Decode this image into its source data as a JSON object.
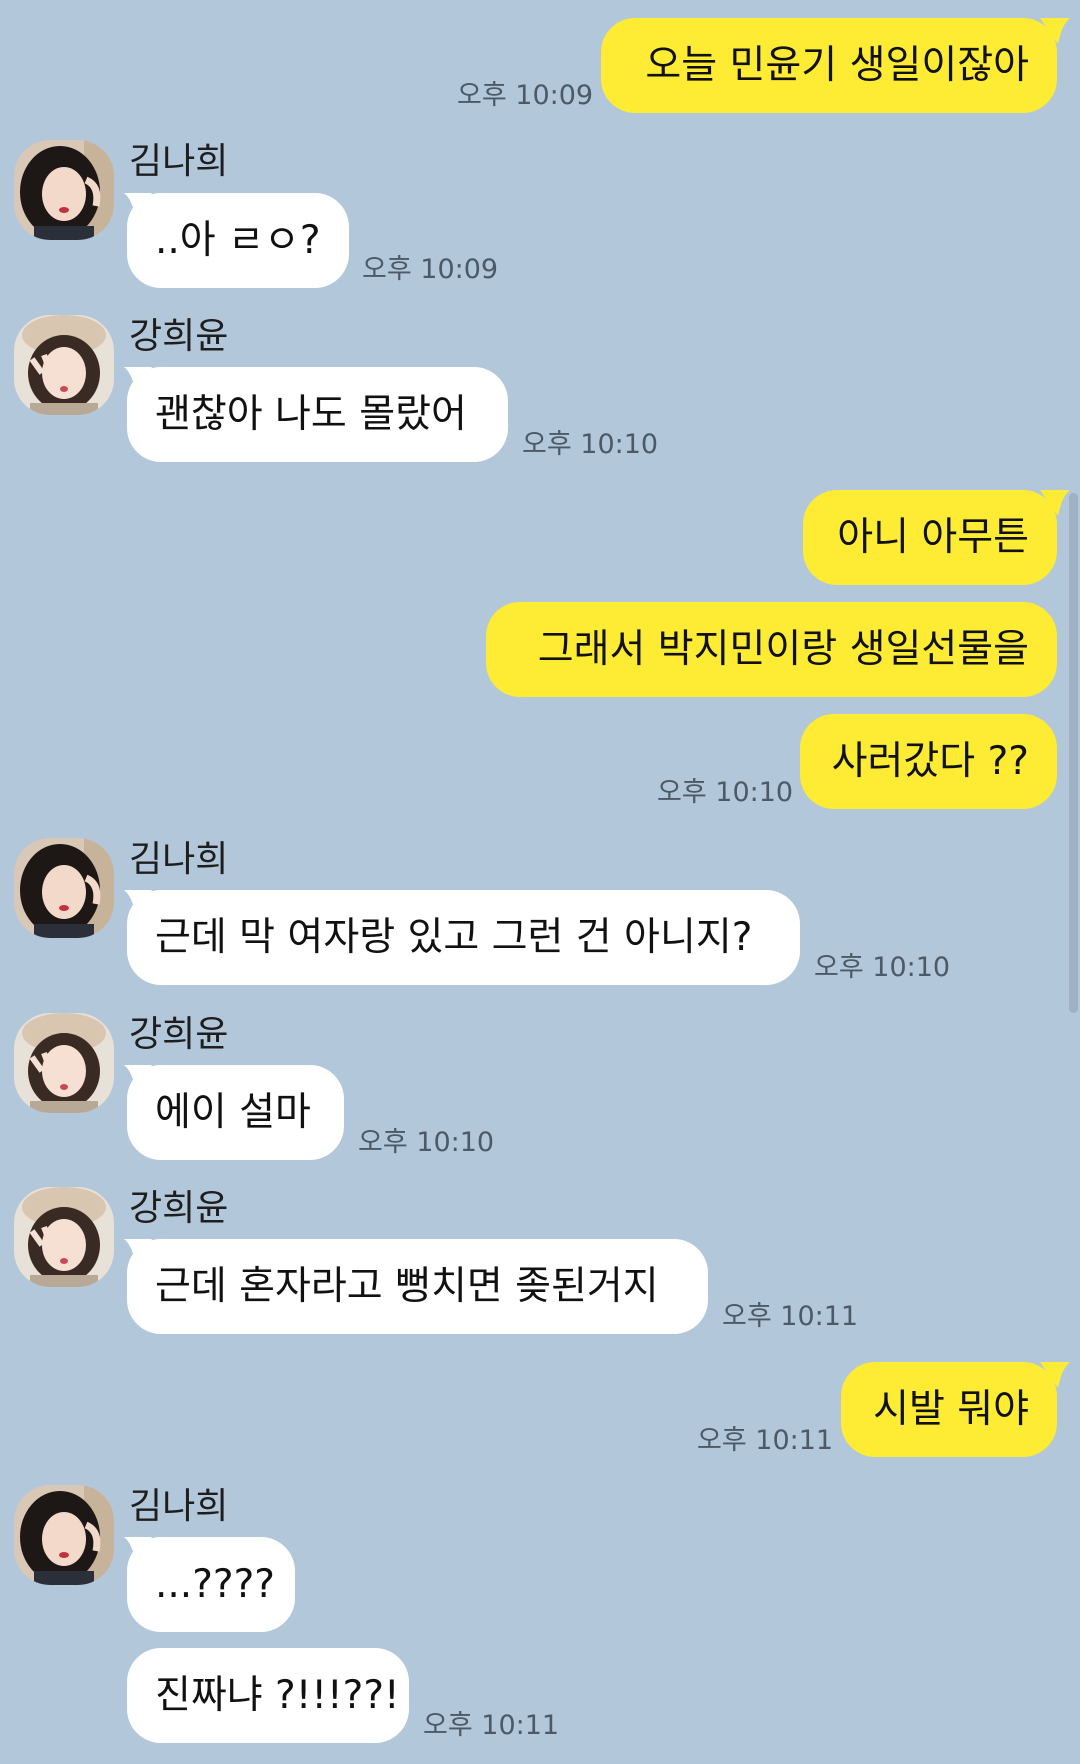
{
  "contacts": {
    "kim": {
      "name": "김나희"
    },
    "kang": {
      "name": "강희윤"
    }
  },
  "messages": [
    {
      "id": "m1",
      "side": "out",
      "text": "오늘 민윤기 생일이잖아",
      "time": "오후 10:09"
    },
    {
      "id": "m2",
      "side": "in",
      "sender": "김나희",
      "text": "..아 ㄹㅇ?",
      "time": "오후 10:09"
    },
    {
      "id": "m3",
      "side": "in",
      "sender": "강희윤",
      "text": "괜찮아 나도 몰랐어",
      "time": "오후 10:10"
    },
    {
      "id": "m4",
      "side": "out",
      "text": "아니 아무튼"
    },
    {
      "id": "m5",
      "side": "out",
      "text": "그래서 박지민이랑 생일선물을"
    },
    {
      "id": "m6",
      "side": "out",
      "text": "사러갔다 ??",
      "time": "오후 10:10"
    },
    {
      "id": "m7",
      "side": "in",
      "sender": "김나희",
      "text": "근데 막 여자랑 있고 그런 건 아니지?",
      "time": "오후 10:10"
    },
    {
      "id": "m8",
      "side": "in",
      "sender": "강희윤",
      "text": "에이 설마",
      "time": "오후 10:10"
    },
    {
      "id": "m9",
      "side": "in",
      "sender": "강희윤",
      "text": "근데 혼자라고 뻥치면 좆된거지",
      "time": "오후 10:11"
    },
    {
      "id": "m10",
      "side": "out",
      "text": "시발 뭐야",
      "time": "오후 10:11"
    },
    {
      "id": "m11",
      "side": "in",
      "sender": "김나희",
      "text": "...????"
    },
    {
      "id": "m12",
      "side": "in",
      "sender": "김나희",
      "text": "진짜냐 ?!!!??!",
      "time": "오후 10:11"
    }
  ],
  "colors": {
    "background": "#b2c7da",
    "outgoing_bubble": "#fdeb34",
    "incoming_bubble": "#ffffff",
    "timestamp": "#4c5966"
  }
}
